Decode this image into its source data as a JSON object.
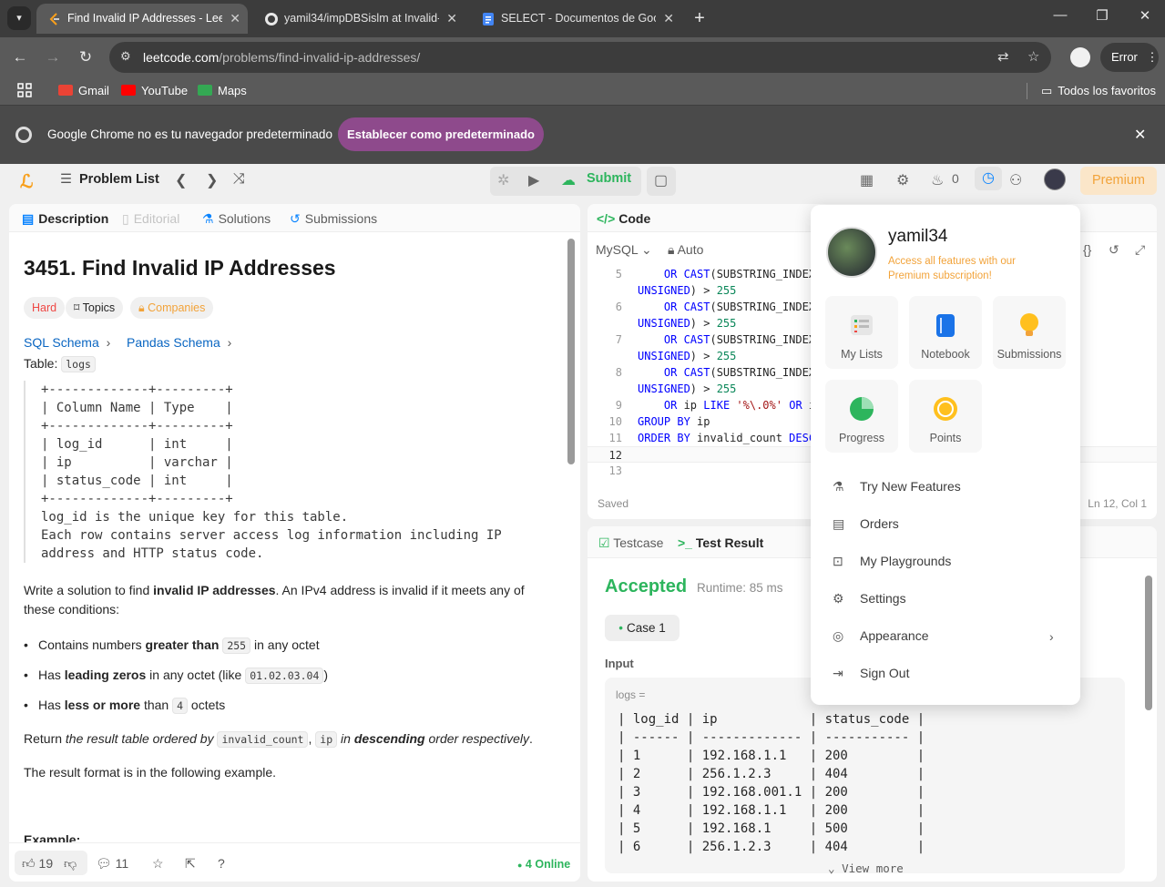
{
  "browser": {
    "tabs": [
      {
        "title": "Find Invalid IP Addresses - Leet"
      },
      {
        "title": "yamil34/impDBSislm at Invalid-I"
      },
      {
        "title": "SELECT - Documentos de Goog"
      }
    ],
    "url_host": "leetcode.com",
    "url_path": "/problems/find-invalid-ip-addresses/",
    "error_label": "Error",
    "bookmarks": [
      "Gmail",
      "YouTube",
      "Maps"
    ],
    "all_bookmarks": "Todos los favoritos",
    "infobar_message": "Google Chrome no es tu navegador predeterminado",
    "infobar_button": "Establecer como predeterminado"
  },
  "nav": {
    "problem_list": "Problem List",
    "submit": "Submit",
    "streak": "0",
    "premium": "Premium"
  },
  "left": {
    "tabs": [
      "Description",
      "Editorial",
      "Solutions",
      "Submissions"
    ],
    "title": "3451. Find Invalid IP Addresses",
    "difficulty": "Hard",
    "topics": "Topics",
    "companies": "Companies",
    "schema1": "SQL Schema",
    "schema2": "Pandas Schema",
    "table_label": "Table:",
    "table_name": "logs",
    "schema_lines": [
      "+-------------+---------+",
      "| Column Name | Type    |",
      "+-------------+---------+",
      "| log_id      | int     |",
      "| ip          | varchar |",
      "| status_code | int     |",
      "+-------------+---------+",
      "log_id is the unique key for this table.",
      "Each row contains server access log information including IP",
      "address and HTTP status code."
    ],
    "intro_a": "Write a solution to find ",
    "intro_b": "invalid IP addresses",
    "intro_c": ". An IPv4 address is invalid if it meets any of",
    "intro_d": "these conditions:",
    "b1a": "Contains numbers ",
    "b1b": "greater than",
    "b1c": "255",
    "b1d": " in any octet",
    "b2a": "Has ",
    "b2b": "leading zeros",
    "b2c": " in any octet (like ",
    "b2d": "01.02.03.04",
    "b2e": ")",
    "b3a": "Has ",
    "b3b": "less or more",
    "b3c": " than ",
    "b3d": "4",
    "b3e": " octets",
    "ret_a": "Return ",
    "ret_b": "the result table ordered by ",
    "ret_c": "invalid_count",
    "ret_d": ", ",
    "ret_e": "ip",
    "ret_f": " in ",
    "ret_g": "descending",
    "ret_h": " order respectively",
    "ret_i": ".",
    "format": "The result format is in the following example.",
    "example": "Example:",
    "likes": "19",
    "comments": "11",
    "online": "4 Online"
  },
  "code": {
    "header": "Code",
    "language": "MySQL",
    "auto": "Auto",
    "saved": "Saved",
    "cursor": "Ln 12, Col 1",
    "lines": [
      {
        "n": "5",
        "t": "    OR CAST(SUBSTRING_INDEX"
      },
      {
        "n": "",
        "t": "UNSIGNED) > 255"
      },
      {
        "n": "6",
        "t": "    OR CAST(SUBSTRING_INDEX"
      },
      {
        "n": "",
        "t": "UNSIGNED) > 255"
      },
      {
        "n": "7",
        "t": "    OR CAST(SUBSTRING_INDEX"
      },
      {
        "n": "",
        "t": "UNSIGNED) > 255"
      },
      {
        "n": "8",
        "t": "    OR CAST(SUBSTRING_INDEX"
      },
      {
        "n": "",
        "t": "UNSIGNED) > 255"
      },
      {
        "n": "9",
        "t": "    OR ip LIKE '%\\.0%' OR i"
      },
      {
        "n": "10",
        "t": "GROUP BY ip"
      },
      {
        "n": "11",
        "t": "ORDER BY invalid_count DESC"
      },
      {
        "n": "12",
        "t": ""
      },
      {
        "n": "13",
        "t": ""
      }
    ]
  },
  "test": {
    "tab1": "Testcase",
    "tab2": "Test Result",
    "status": "Accepted",
    "runtime": "Runtime: 85 ms",
    "case": "Case 1",
    "input_label": "Input",
    "var": "logs =",
    "rows": [
      "| log_id | ip            | status_code |",
      "| ------ | ------------- | ----------- |",
      "| 1      | 192.168.1.1   | 200         |",
      "| 2      | 256.1.2.3     | 404         |",
      "| 3      | 192.168.001.1 | 200         |",
      "| 4      | 192.168.1.1   | 200         |",
      "| 5      | 192.168.1     | 500         |",
      "| 6      | 256.1.2.3     | 404         |"
    ],
    "view_more": "View more"
  },
  "menu": {
    "username": "yamil34",
    "promo": "Access all features with our Premium subscription!",
    "tiles": [
      "My Lists",
      "Notebook",
      "Submissions",
      "Progress",
      "Points"
    ],
    "items": [
      "Try New Features",
      "Orders",
      "My Playgrounds",
      "Settings",
      "Appearance",
      "Sign Out"
    ]
  }
}
